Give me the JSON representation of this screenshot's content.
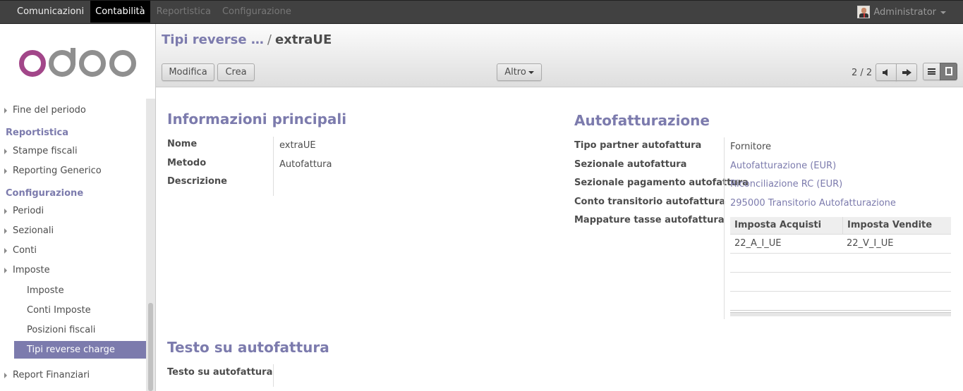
{
  "topbar": {
    "menu": [
      "Comunicazioni",
      "Contabilità",
      "Reportistica",
      "Configurazione"
    ],
    "user": "Administrator"
  },
  "sidebar": {
    "logo": "odoo",
    "items": {
      "fine_periodo": "Fine del periodo",
      "head_reportistica": "Reportistica",
      "stampe_fiscali": "Stampe fiscali",
      "reporting_generico": "Reporting Generico",
      "head_configurazione": "Configurazione",
      "periodi": "Periodi",
      "sezionali": "Sezionali",
      "conti": "Conti",
      "imposte": "Imposte",
      "sub_imposte": "Imposte",
      "conti_imposte": "Conti Imposte",
      "posizioni_fiscali": "Posizioni fiscali",
      "tipi_reverse_charge": "Tipi reverse charge",
      "report_finanziari": "Report Finanziari"
    }
  },
  "header": {
    "breadcrumb_parent": "Tipi reverse …",
    "breadcrumb_sep": "/",
    "breadcrumb_current": "extraUE",
    "edit_label": "Modifica",
    "create_label": "Crea",
    "more_label": "Altro",
    "pager": "2 / 2"
  },
  "form": {
    "main_title": "Informazioni principali",
    "nome_label": "Nome",
    "nome_value": "extraUE",
    "metodo_label": "Metodo",
    "metodo_value": "Autofattura",
    "descrizione_label": "Descrizione",
    "auto_title": "Autofatturazione",
    "tipo_partner_label": "Tipo partner autofattura",
    "tipo_partner_value": "Fornitore",
    "sezionale_label": "Sezionale autofattura",
    "sezionale_value": "Autofatturazione (EUR)",
    "sezionale_pag_label": "Sezionale pagamento autofattura",
    "sezionale_pag_value": "Riconciliazione RC (EUR)",
    "conto_trans_label": "Conto transitorio autofattura",
    "conto_trans_value": "295000 Transitorio Autofatturazione",
    "mappature_label": "Mappature tasse autofattura",
    "table": {
      "headers": [
        "Imposta Acquisti",
        "Imposta Vendite"
      ],
      "rows": [
        [
          "22_A_I_UE",
          "22_V_I_UE"
        ]
      ]
    },
    "testo_title": "Testo su autofattura",
    "testo_label": "Testo su autofattura"
  }
}
